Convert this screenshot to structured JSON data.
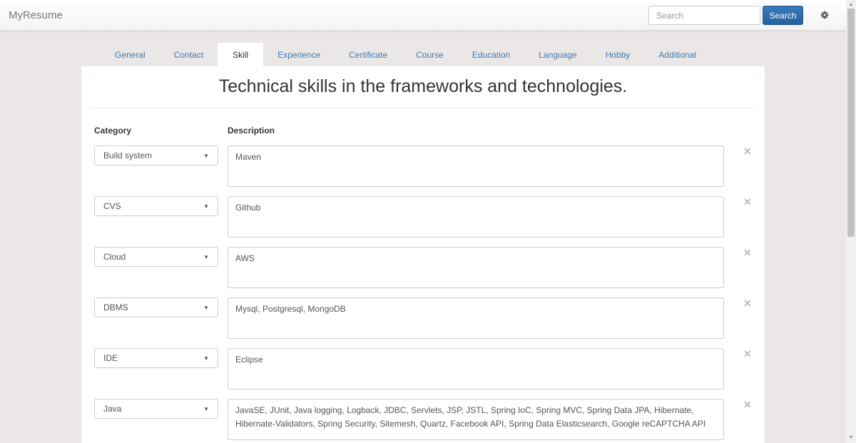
{
  "navbar": {
    "brand": "MyResume",
    "search_placeholder": "Search",
    "search_value": "",
    "search_button": "Search",
    "settings_icon": "gear-icon"
  },
  "tabs": [
    {
      "label": "General",
      "active": false
    },
    {
      "label": "Contact",
      "active": false
    },
    {
      "label": "Skill",
      "active": true
    },
    {
      "label": "Experience",
      "active": false
    },
    {
      "label": "Certificate",
      "active": false
    },
    {
      "label": "Course",
      "active": false
    },
    {
      "label": "Education",
      "active": false
    },
    {
      "label": "Language",
      "active": false
    },
    {
      "label": "Hobby",
      "active": false
    },
    {
      "label": "Additional",
      "active": false
    }
  ],
  "main": {
    "title": "Technical skills in the frameworks and technologies.",
    "columns": {
      "category": "Category",
      "description": "Description"
    },
    "skills": [
      {
        "category": "Build system",
        "description": "Maven"
      },
      {
        "category": "CVS",
        "description": "Github"
      },
      {
        "category": "Cloud",
        "description": "AWS"
      },
      {
        "category": "DBMS",
        "description": "Mysql, Postgresql, MongoDB"
      },
      {
        "category": "IDE",
        "description": "Eclipse"
      },
      {
        "category": "Java",
        "description": "JavaSE, JUnit, Java logging, Logback, JDBC, Servlets, JSP, JSTL, Spring IoC, Spring MVC, Spring Data JPA, Hibernate, Hibernate-Validators, Spring Security, Sitemesh, Quartz, Facebook API, Spring Data Elasticsearch, Google reCAPTCHA API"
      }
    ],
    "remove_icon": "close-icon",
    "caret_icon": "caret-down-icon"
  }
}
